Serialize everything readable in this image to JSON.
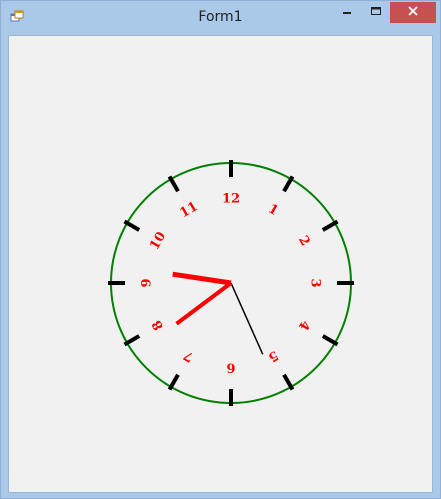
{
  "window": {
    "title": "Form1"
  },
  "titlebar_buttons": {
    "minimize": "minimize-icon",
    "maximize": "maximize-icon",
    "close": "close-icon"
  },
  "clock": {
    "time": {
      "hour": 7,
      "minute": 46,
      "second": 26
    },
    "numerals": [
      "12",
      "1",
      "2",
      "3",
      "4",
      "5",
      "6",
      "7",
      "8",
      "9",
      "10",
      "11"
    ],
    "colors": {
      "face_border": "#008000",
      "numerals": "#ff0000",
      "ticks": "#000000",
      "hour_hand": "#ff0000",
      "minute_hand": "#ff0000",
      "second_hand": "#000000"
    }
  }
}
